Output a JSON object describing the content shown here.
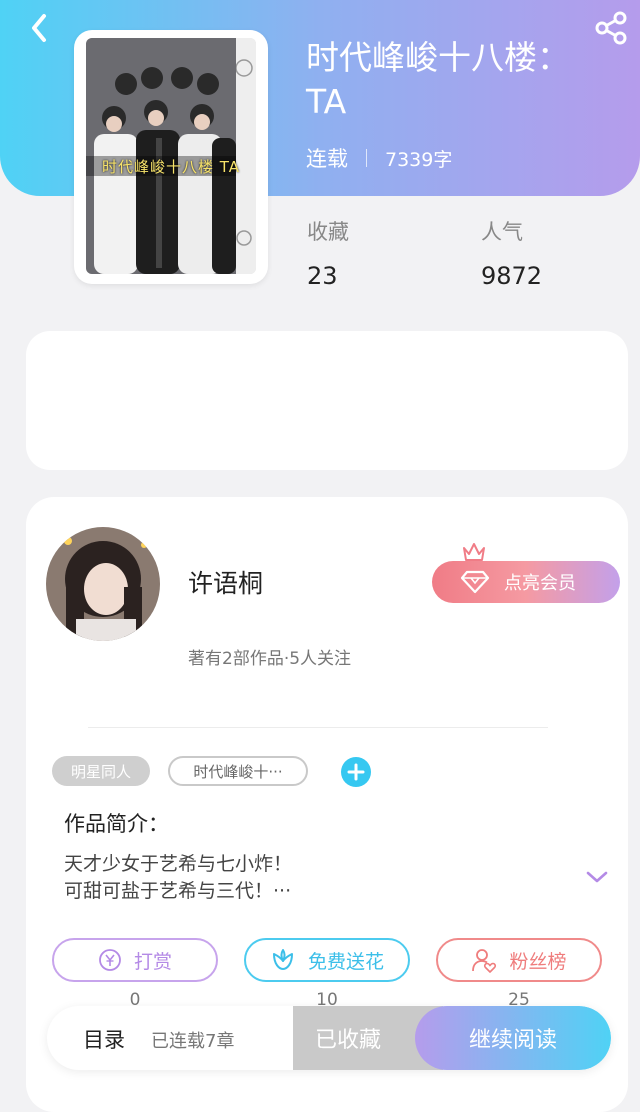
{
  "book": {
    "title": "时代峰峻十八楼：TA",
    "cover_caption": "时代峰峻十八楼 TA",
    "status": "连载",
    "word_count": "7339字",
    "stats": [
      {
        "label": "收藏",
        "value": "23"
      },
      {
        "label": "人气",
        "value": "9872"
      }
    ]
  },
  "author": {
    "name": "许语桐",
    "meta": "著有2部作品·5人关注",
    "vip_label": "点亮会员"
  },
  "tags": {
    "genre": "明星同人",
    "title_tag": "时代峰峻十···"
  },
  "intro": {
    "label": "作品简介：",
    "line1": "天才少女于艺希与七小炸！",
    "line2": "可甜可盐于艺希与三代！···"
  },
  "actions": [
    {
      "label": "打赏",
      "count": "0"
    },
    {
      "label": "免费送花",
      "count": "10"
    },
    {
      "label": "粉丝榜",
      "count": "25"
    }
  ],
  "bottom_bar": {
    "toc_label": "目录",
    "toc_meta": "已连载7章",
    "collected_label": "已收藏",
    "read_label": "继续阅读"
  },
  "colors": {
    "header_gradient_start": "#4fd2f5",
    "header_gradient_end": "#b59cec",
    "accent_blue": "#36c8f1",
    "accent_pink": "#f07c86",
    "accent_purple": "#b48ae6"
  }
}
